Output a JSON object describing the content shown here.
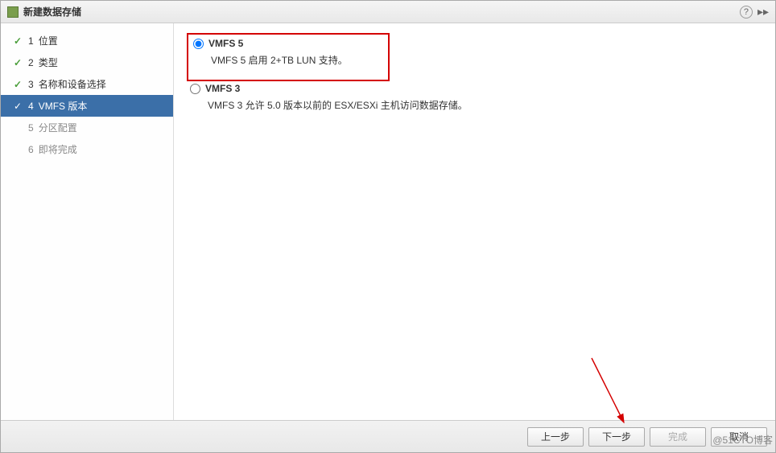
{
  "titlebar": {
    "title": "新建数据存储",
    "help_symbol": "?",
    "expand_symbol": "▸▸"
  },
  "sidebar": {
    "steps": [
      {
        "num": "1",
        "label": "位置",
        "state": "completed"
      },
      {
        "num": "2",
        "label": "类型",
        "state": "completed"
      },
      {
        "num": "3",
        "label": "名称和设备选择",
        "state": "completed"
      },
      {
        "num": "4",
        "label": "VMFS 版本",
        "state": "active"
      },
      {
        "num": "5",
        "label": "分区配置",
        "state": "pending"
      },
      {
        "num": "6",
        "label": "即将完成",
        "state": "pending"
      }
    ]
  },
  "main": {
    "options": [
      {
        "id": "vmfs5",
        "label": "VMFS 5",
        "desc": "VMFS 5 启用 2+TB LUN 支持。",
        "selected": true,
        "highlighted": true
      },
      {
        "id": "vmfs3",
        "label": "VMFS 3",
        "desc": "VMFS 3 允许 5.0 版本以前的 ESX/ESXi 主机访问数据存储。",
        "selected": false,
        "highlighted": false
      }
    ]
  },
  "footer": {
    "back": "上一步",
    "next": "下一步",
    "finish": "完成",
    "cancel": "取消"
  },
  "watermark": "@51CTO博客"
}
